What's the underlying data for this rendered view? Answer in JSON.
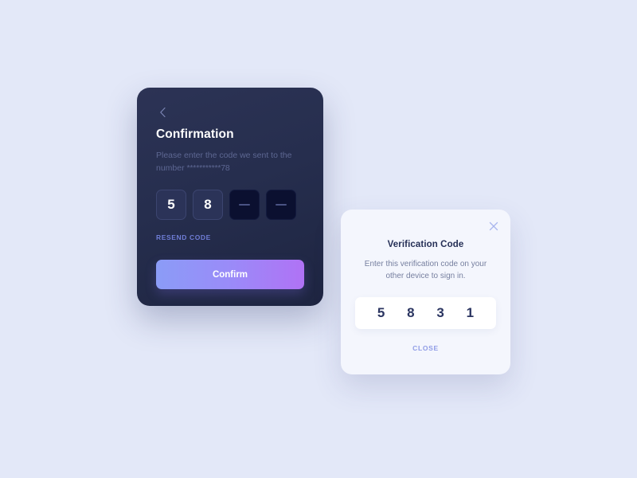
{
  "page": {
    "background_color": "#e3e8f8"
  },
  "confirmation_card": {
    "back_icon": "chevron-left-icon",
    "title": "Confirmation",
    "subtitle_line1": "Please enter the code we sent to the",
    "subtitle_line2_prefix": "number ",
    "subtitle_masked": "***********78",
    "code_inputs": [
      {
        "value": "5",
        "state": "filled"
      },
      {
        "value": "8",
        "state": "filled"
      },
      {
        "value": "",
        "state": "empty"
      },
      {
        "value": "",
        "state": "empty"
      }
    ],
    "resend_label": "RESEND CODE",
    "confirm_label": "Confirm",
    "accent_gradient_start": "#8b9cf7",
    "accent_gradient_end": "#b072f5",
    "card_bg_start": "#2c3355",
    "card_bg_end": "#1e2541"
  },
  "verification_modal": {
    "close_icon": "close-x-icon",
    "title": "Verification Code",
    "description_line1": "Enter this verification code on your",
    "description_line2": "other device to sign in.",
    "code_digits": [
      "5",
      "8",
      "3",
      "1"
    ],
    "close_label": "CLOSE",
    "bg_color": "#f4f6fd",
    "strip_color": "#ffffff",
    "link_color": "#8f9ce6"
  }
}
